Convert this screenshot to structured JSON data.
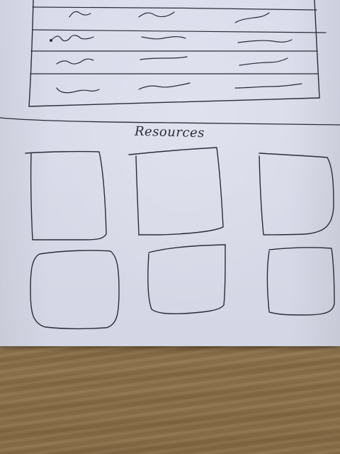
{
  "resources_section": {
    "title": "Resources",
    "card_count": 6
  },
  "table": {
    "row_count": 5,
    "column_count": 3
  },
  "colors": {
    "ink": "#2b2c37",
    "paper": "#dadcec",
    "desk": "#9b7e55"
  }
}
